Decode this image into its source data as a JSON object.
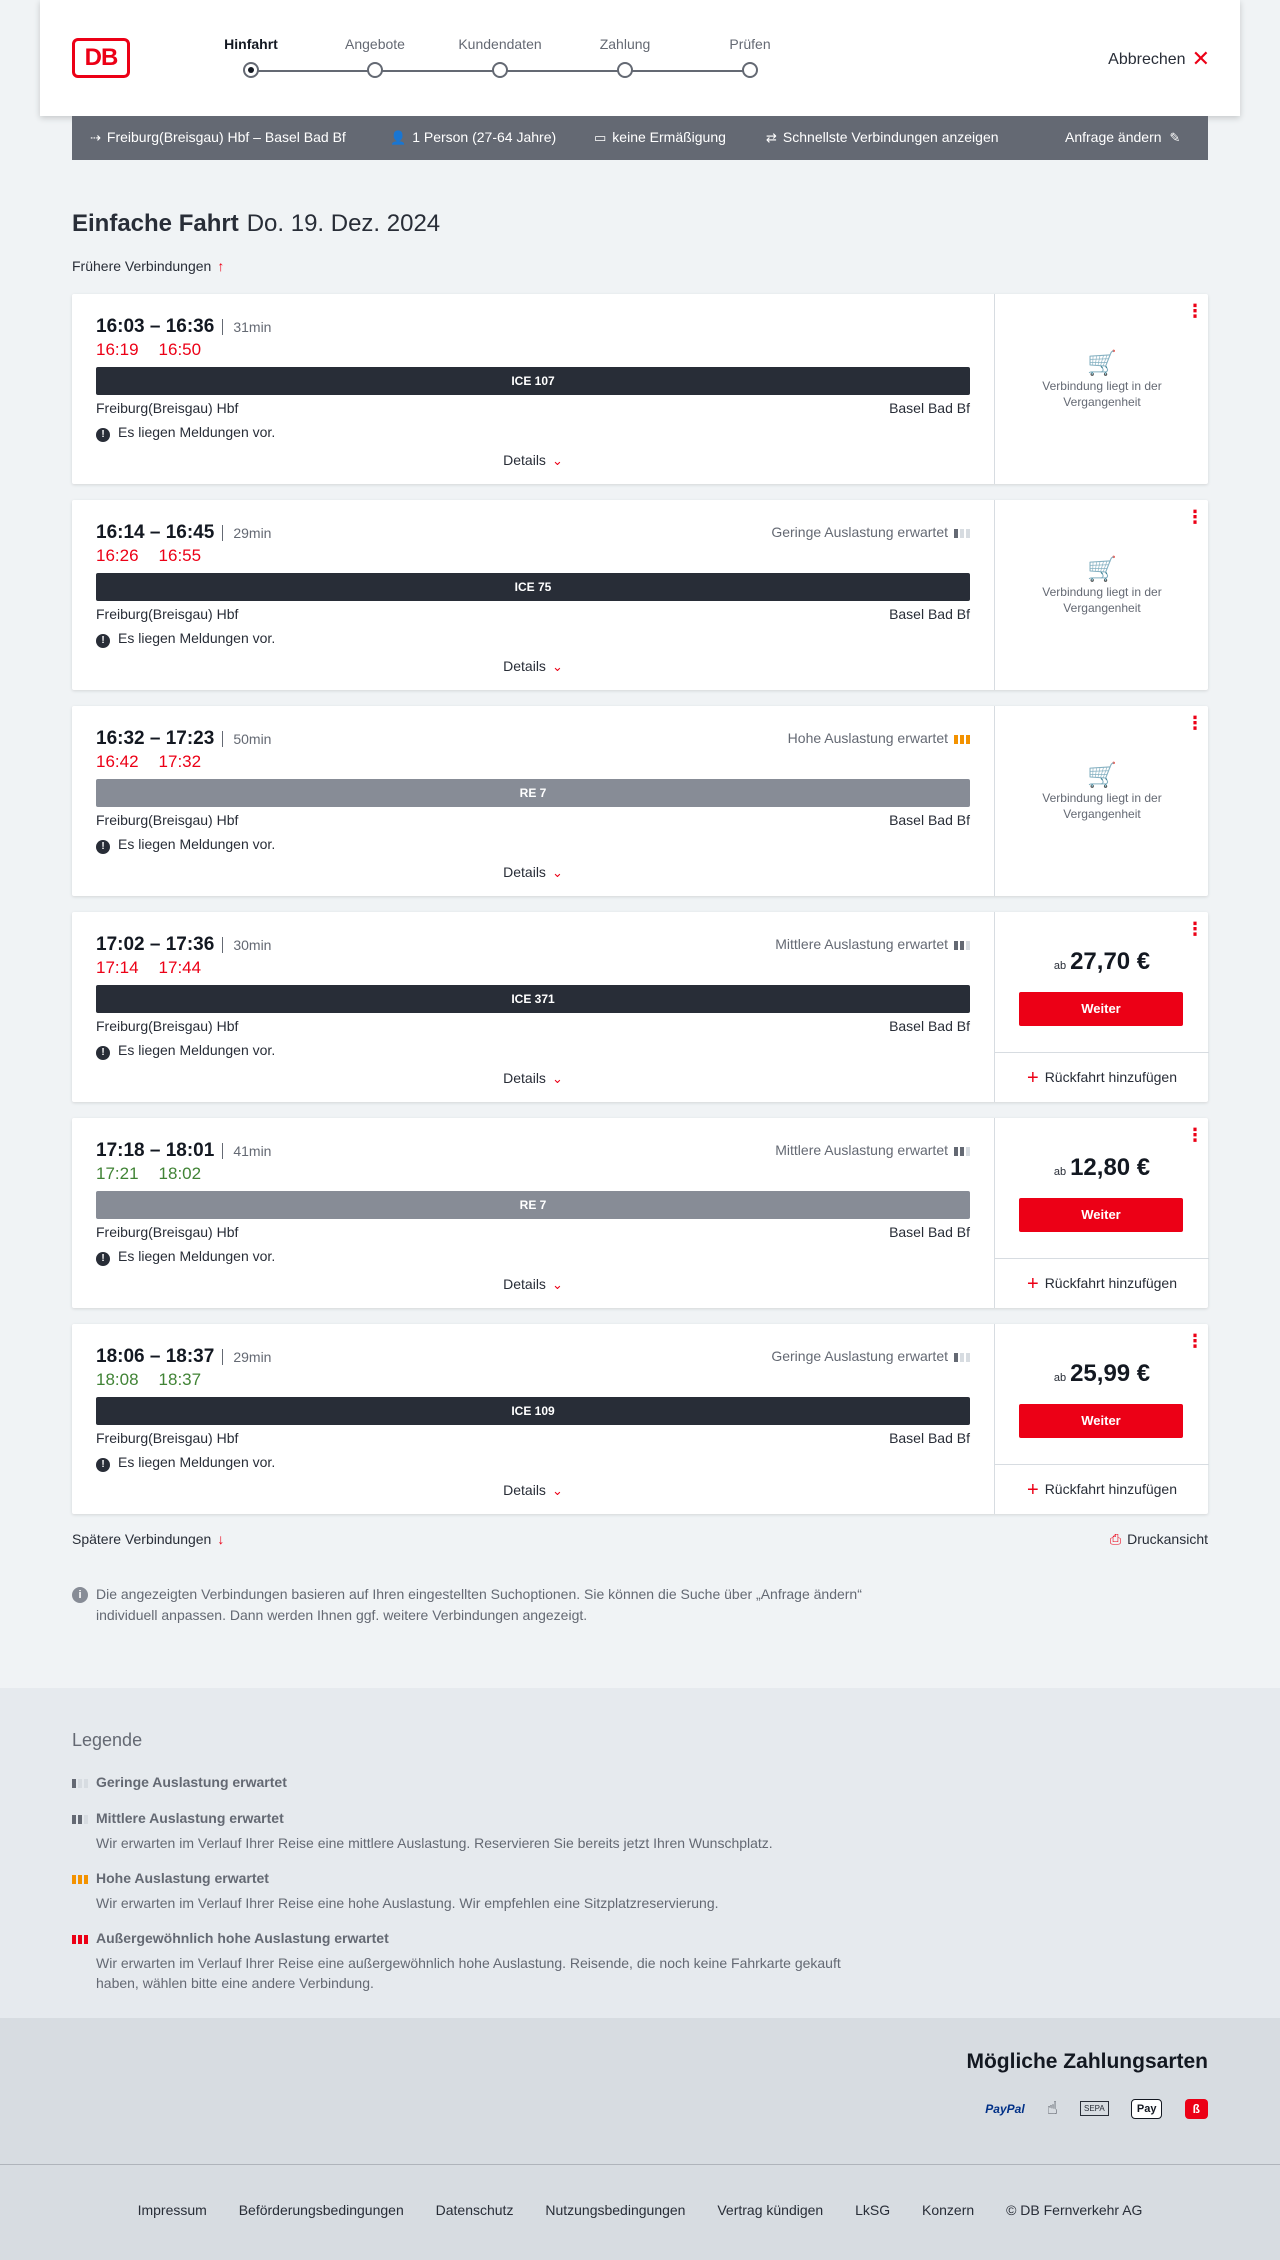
{
  "header": {
    "logo": "DB",
    "steps": [
      {
        "label": "Hinfahrt",
        "active": true
      },
      {
        "label": "Angebote",
        "active": false
      },
      {
        "label": "Kundendaten",
        "active": false
      },
      {
        "label": "Zahlung",
        "active": false
      },
      {
        "label": "Prüfen",
        "active": false
      }
    ],
    "cancel_label": "Abbrechen"
  },
  "searchbar": {
    "route": "Freiburg(Breisgau) Hbf – Basel Bad Bf",
    "passengers": "1 Person (27-64 Jahre)",
    "discount": "keine Ermäßigung",
    "fastest": "Schnellste Verbindungen anzeigen",
    "change": "Anfrage ändern"
  },
  "title": {
    "trip_type": "Einfache Fahrt",
    "date": "Do. 19. Dez. 2024"
  },
  "earlier_label": "Frühere Verbindungen",
  "later_label": "Spätere Verbindungen",
  "print_label": "Druckansicht",
  "details_label": "Details",
  "messages_label": "Es liegen Meldungen vor.",
  "past_label": "Verbindung liegt in der Vergangenheit",
  "weiter_label": "Weiter",
  "return_label": "Rückfahrt hinzufügen",
  "price_prefix": "ab",
  "connections": [
    {
      "times": "16:03 – 16:36",
      "duration": "31min",
      "rt_dep": "16:19",
      "rt_arr": "16:50",
      "rt_status": "late",
      "occupancy": "",
      "occ_level": "",
      "train": "ICE 107",
      "train_type": "ice",
      "from": "Freiburg(Breisgau) Hbf",
      "to": "Basel Bad Bf",
      "price": null
    },
    {
      "times": "16:14 – 16:45",
      "duration": "29min",
      "rt_dep": "16:26",
      "rt_arr": "16:55",
      "rt_status": "late",
      "occupancy": "Geringe Auslastung erwartet",
      "occ_level": "low",
      "train": "ICE 75",
      "train_type": "ice",
      "from": "Freiburg(Breisgau) Hbf",
      "to": "Basel Bad Bf",
      "price": null
    },
    {
      "times": "16:32 – 17:23",
      "duration": "50min",
      "rt_dep": "16:42",
      "rt_arr": "17:32",
      "rt_status": "late",
      "occupancy": "Hohe Auslastung erwartet",
      "occ_level": "high",
      "train": "RE 7",
      "train_type": "re",
      "from": "Freiburg(Breisgau) Hbf",
      "to": "Basel Bad Bf",
      "price": null
    },
    {
      "times": "17:02 – 17:36",
      "duration": "30min",
      "rt_dep": "17:14",
      "rt_arr": "17:44",
      "rt_status": "late",
      "occupancy": "Mittlere Auslastung erwartet",
      "occ_level": "mid",
      "train": "ICE 371",
      "train_type": "ice",
      "from": "Freiburg(Breisgau) Hbf",
      "to": "Basel Bad Bf",
      "price": "27,70 €"
    },
    {
      "times": "17:18 – 18:01",
      "duration": "41min",
      "rt_dep": "17:21",
      "rt_arr": "18:02",
      "rt_status": "ok",
      "occupancy": "Mittlere Auslastung erwartet",
      "occ_level": "mid",
      "train": "RE 7",
      "train_type": "re",
      "from": "Freiburg(Breisgau) Hbf",
      "to": "Basel Bad Bf",
      "price": "12,80 €"
    },
    {
      "times": "18:06 – 18:37",
      "duration": "29min",
      "rt_dep": "18:08",
      "rt_arr": "18:37",
      "rt_status": "ok",
      "occupancy": "Geringe Auslastung erwartet",
      "occ_level": "low",
      "train": "ICE 109",
      "train_type": "ice",
      "from": "Freiburg(Breisgau) Hbf",
      "to": "Basel Bad Bf",
      "price": "25,99 €"
    }
  ],
  "info_text": "Die angezeigten Verbindungen basieren auf Ihren eingestellten Suchoptionen. Sie können die Suche über „Anfrage ändern“ individuell anpassen. Dann werden Ihnen ggf. weitere Verbindungen angezeigt.",
  "legend": {
    "title": "Legende",
    "items": [
      {
        "title": "Geringe Auslastung erwartet",
        "desc": "",
        "level": "low"
      },
      {
        "title": "Mittlere Auslastung erwartet",
        "desc": "Wir erwarten im Verlauf Ihrer Reise eine mittlere Auslastung. Reservieren Sie bereits jetzt Ihren Wunschplatz.",
        "level": "mid"
      },
      {
        "title": "Hohe Auslastung erwartet",
        "desc": "Wir erwarten im Verlauf Ihrer Reise eine hohe Auslastung. Wir empfehlen eine Sitzplatzreservierung.",
        "level": "high"
      },
      {
        "title": "Außergewöhnlich hohe Auslastung erwartet",
        "desc": "Wir erwarten im Verlauf Ihrer Reise eine außergewöhnlich hohe Auslastung. Reisende, die noch keine Fahrkarte gekauft haben, wählen bitte eine andere Verbindung.",
        "level": "ext"
      }
    ]
  },
  "payment": {
    "title": "Mögliche Zahlungsarten",
    "paypal": "PayPal",
    "sepa": "SEPA",
    "applepay": "Pay"
  },
  "footer": {
    "links": [
      "Impressum",
      "Beförderungsbedingungen",
      "Datenschutz",
      "Nutzungsbedingungen",
      "Vertrag kündigen",
      "LkSG",
      "Konzern",
      "© DB Fernverkehr AG"
    ]
  },
  "colors": {
    "accent": "#ec0016",
    "late": "#ec0016",
    "on_time": "#408335",
    "ice_bar": "#282d37",
    "re_bar": "#878c96",
    "high_occ": "#f39200"
  }
}
